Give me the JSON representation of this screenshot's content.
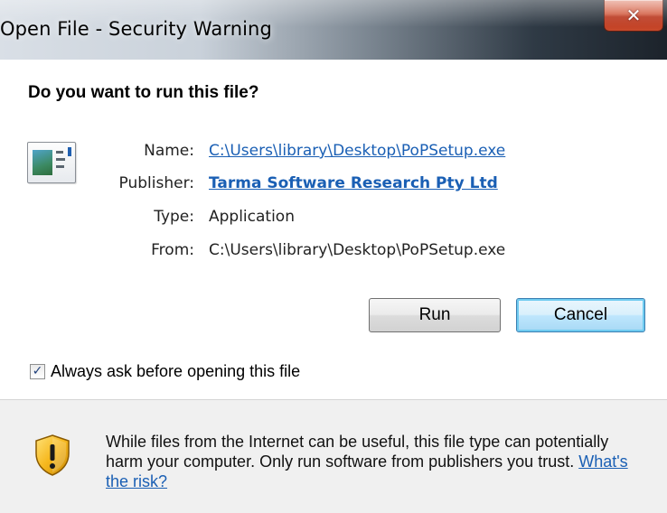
{
  "window": {
    "title": "Open File - Security Warning",
    "close_glyph": "✕"
  },
  "prompt": {
    "question": "Do you want to run this file?"
  },
  "file_info": {
    "name_label": "Name:",
    "name_value": "C:\\Users\\library\\Desktop\\PoPSetup.exe",
    "publisher_label": "Publisher:",
    "publisher_value": "Tarma Software Research Pty Ltd",
    "type_label": "Type:",
    "type_value": "Application",
    "from_label": "From:",
    "from_value": "C:\\Users\\library\\Desktop\\PoPSetup.exe"
  },
  "buttons": {
    "run": "Run",
    "cancel": "Cancel"
  },
  "checkbox": {
    "label": "Always ask before opening this file",
    "checked": true
  },
  "footer": {
    "warning_text": "While files from the Internet can be useful, this file type can potentially harm your computer. Only run software from publishers you trust.",
    "risk_link": "What's the risk?"
  },
  "icons": {
    "file": "application-file-icon",
    "warning": "shield-warning-icon",
    "close": "close-icon",
    "check": "checkmark-icon"
  },
  "colors": {
    "link": "#1a5fb4",
    "close_button": "#c84a2c",
    "default_button_border": "#3c7fb1",
    "footer_background": "#f0f0f0"
  }
}
